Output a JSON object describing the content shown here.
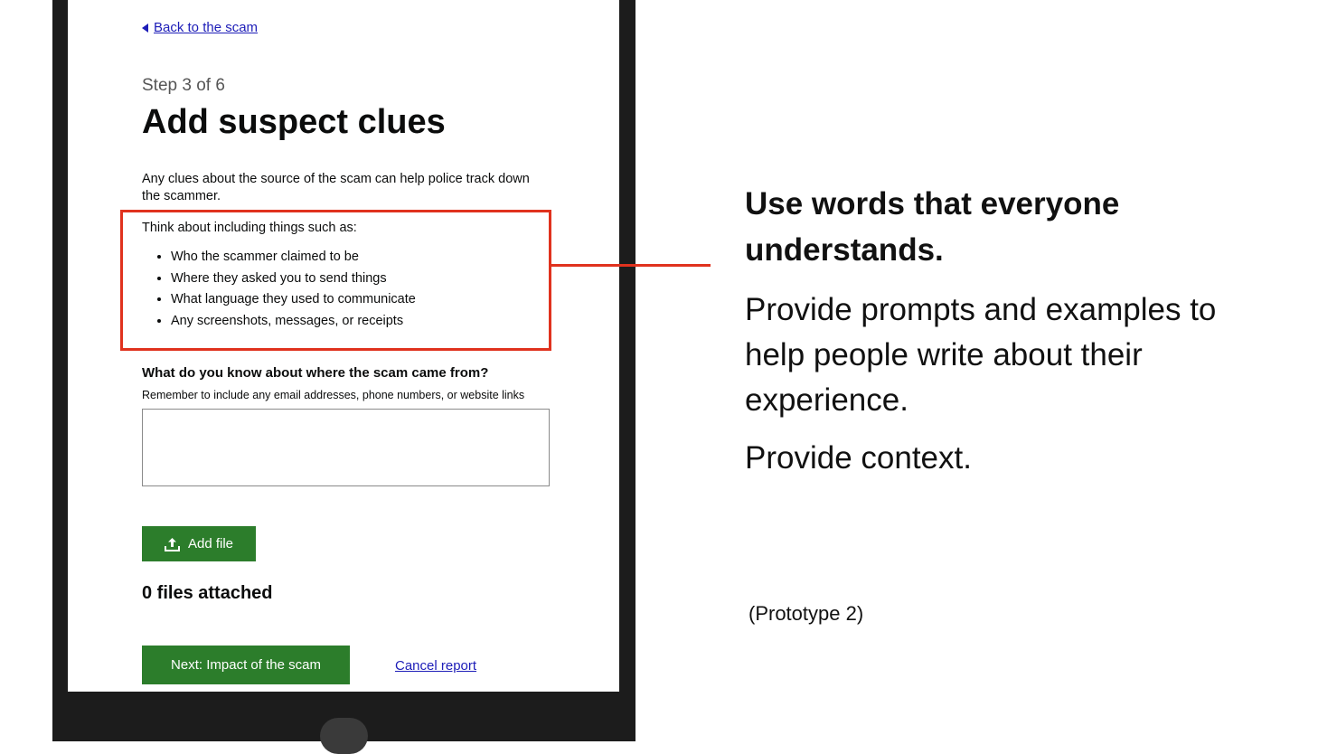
{
  "form": {
    "back_link": "Back to the scam",
    "step": "Step 3 of 6",
    "title": "Add suspect clues",
    "intro": "Any clues about the source of the scam can help police track down the scammer.",
    "hint_intro": "Think about including things such as:",
    "hint_items": [
      "Who the scammer claimed to be",
      "Where they asked you to send things",
      "What language they used to communicate",
      "Any screenshots, messages, or receipts"
    ],
    "question_label": "What do you know about where the scam came from?",
    "question_hint": "Remember to include any email addresses, phone numbers, or website links",
    "textarea_value": "",
    "add_file_label": "Add file",
    "files_attached": "0 files attached",
    "next_label": "Next: Impact of the scam",
    "cancel_label": "Cancel report"
  },
  "notes": {
    "heading": "Use words that everyone understands.",
    "p1": "Provide prompts and examples to help people write about their experience.",
    "p2": "Provide context.",
    "caption": "(Prototype 2)"
  },
  "colors": {
    "highlight": "#e0321e",
    "button_green": "#2c7d2b",
    "link_blue": "#1d1db8",
    "device_frame": "#1c1c1c"
  },
  "icons": {
    "back": "triangle-left-icon",
    "upload": "upload-icon"
  }
}
